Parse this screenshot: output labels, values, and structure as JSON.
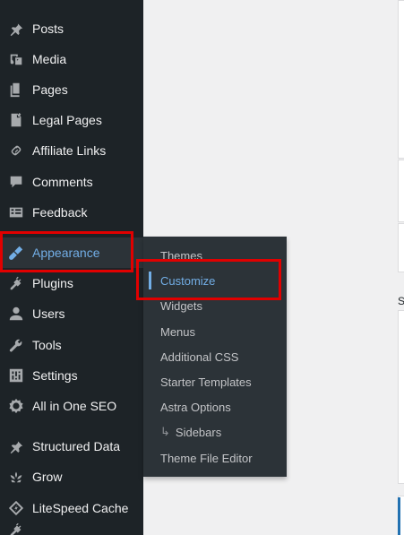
{
  "sidebar": {
    "items": [
      {
        "label": "",
        "icon": "dashboard-icon"
      },
      {
        "label": "Posts",
        "icon": "pin-icon"
      },
      {
        "label": "Media",
        "icon": "media-icon"
      },
      {
        "label": "Pages",
        "icon": "pages-icon"
      },
      {
        "label": "Legal Pages",
        "icon": "legal-pages-icon"
      },
      {
        "label": "Affiliate Links",
        "icon": "link-icon"
      },
      {
        "label": "Comments",
        "icon": "comment-icon"
      },
      {
        "label": "Feedback",
        "icon": "feedback-icon"
      },
      {
        "label": "Appearance",
        "icon": "paintbrush-icon"
      },
      {
        "label": "Plugins",
        "icon": "plugin-icon"
      },
      {
        "label": "Users",
        "icon": "user-icon"
      },
      {
        "label": "Tools",
        "icon": "wrench-icon"
      },
      {
        "label": "Settings",
        "icon": "settings-icon"
      },
      {
        "label": "All in One SEO",
        "icon": "seo-icon"
      },
      {
        "label": "Structured Data",
        "icon": "pin-icon"
      },
      {
        "label": "Grow",
        "icon": "grow-icon"
      },
      {
        "label": "LiteSpeed Cache",
        "icon": "litespeed-icon"
      },
      {
        "label": "",
        "icon": "plugin-icon"
      }
    ]
  },
  "flyout": {
    "items": [
      {
        "label": "Themes"
      },
      {
        "label": "Customize"
      },
      {
        "label": "Widgets"
      },
      {
        "label": "Menus"
      },
      {
        "label": "Additional CSS"
      },
      {
        "label": "Starter Templates"
      },
      {
        "label": "Astra Options"
      },
      {
        "label": "Sidebars",
        "prefix": "↳"
      },
      {
        "label": "Theme File Editor"
      }
    ]
  },
  "main": {
    "side_label": "S"
  },
  "colors": {
    "sidebar_bg": "#1d2327",
    "flyout_bg": "#2c3338",
    "accent": "#72aee6",
    "highlight": "#e10000"
  }
}
